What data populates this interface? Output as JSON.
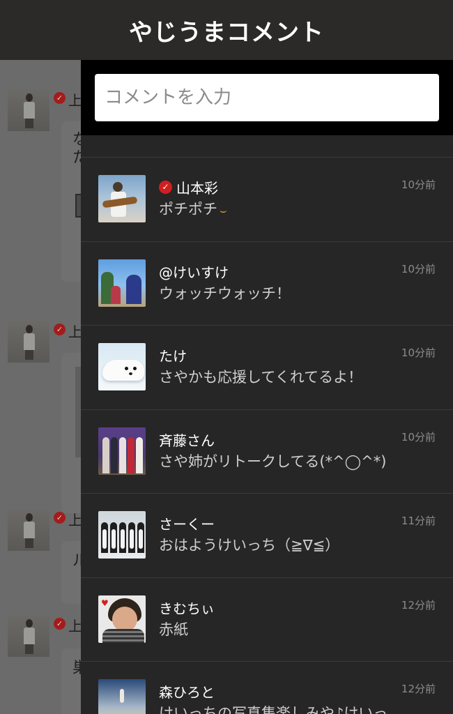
{
  "header": {
    "title": "やじうまコメント"
  },
  "background_feed": {
    "posts": [
      {
        "name_fragment": "上",
        "text_lines": [
          "な",
          "た"
        ]
      },
      {
        "name_fragment": "上"
      },
      {
        "name_fragment": "上",
        "text_lines": [
          "ル"
        ]
      },
      {
        "name_fragment": "上",
        "text_lines": [
          "巣"
        ]
      }
    ]
  },
  "comment_input": {
    "placeholder": "コメントを入力"
  },
  "comments": [
    {
      "name": "山本彩",
      "verified": true,
      "text": "ポチポチ",
      "emoji": "⌣",
      "time": "10分前",
      "avatar_icon": "guitar-photo"
    },
    {
      "name": "@けいすけ",
      "verified": false,
      "text": "ウォッチウォッチ！",
      "time": "10分前",
      "avatar_icon": "anime-photo"
    },
    {
      "name": "たけ",
      "verified": false,
      "text": "さやかも応援してくれてるよ！",
      "time": "10分前",
      "avatar_icon": "seal-photo"
    },
    {
      "name": "斉藤さん",
      "verified": false,
      "text": "さや姉がリトークしてる(*^◯^*)",
      "time": "10分前",
      "avatar_icon": "group-photo"
    },
    {
      "name": "さーくー",
      "verified": false,
      "text": "おはようけいっち（≧∇≦）",
      "time": "11分前",
      "avatar_icon": "penguins-photo"
    },
    {
      "name": "きむちぃ",
      "verified": false,
      "text": "赤紙",
      "time": "12分前",
      "avatar_icon": "face-photo"
    },
    {
      "name": "森ひろと",
      "verified": false,
      "text": "けいっちの写真集楽しみや♪けいっ",
      "time": "12分前",
      "avatar_icon": "night-photo"
    }
  ],
  "colors": {
    "header_bg": "#2c2a29",
    "drawer_bg": "#262626",
    "verified_badge": "#d11f1f",
    "time_text": "#8c8c8c"
  }
}
